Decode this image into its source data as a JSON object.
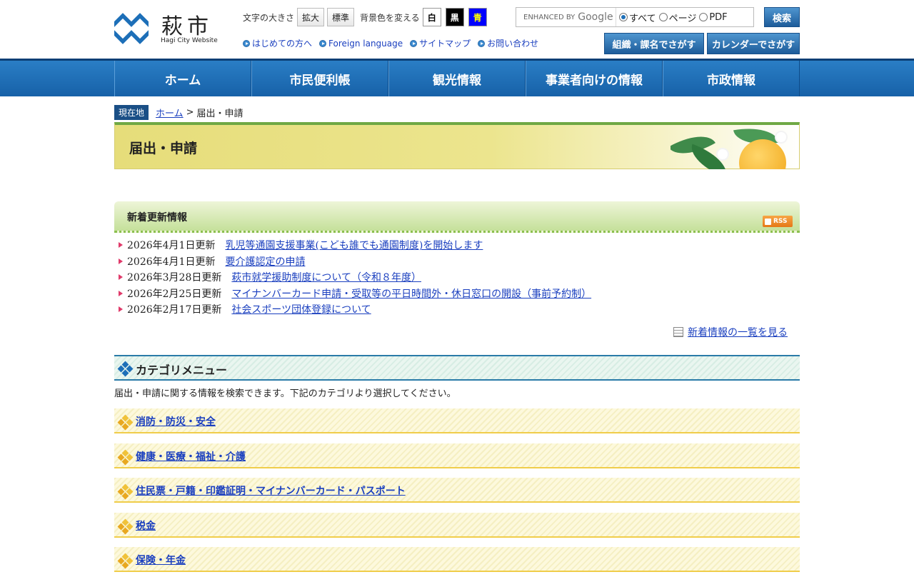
{
  "header": {
    "logo_kanji": "萩市",
    "logo_en": "Hagi City Website",
    "font_size_label": "文字の大きさ",
    "font_enlarge": "拡大",
    "font_standard": "標準",
    "bg_color_label": "背景色を変える",
    "bg_white": "白",
    "bg_black": "黒",
    "bg_blue": "青",
    "links": [
      {
        "label": "はじめての方へ"
      },
      {
        "label": "Foreign language"
      },
      {
        "label": "サイトマップ"
      },
      {
        "label": "お問い合わせ"
      }
    ],
    "search": {
      "enhanced_by": "ENHANCED BY",
      "google": "Google",
      "options": [
        "すべて",
        "ページ",
        "PDF"
      ],
      "selected": "すべて",
      "button": "検索"
    },
    "org_search_button": "組織・課名でさがす",
    "calendar_search_button": "カレンダーでさがす"
  },
  "nav": [
    "ホーム",
    "市民便利帳",
    "観光情報",
    "事業者向けの情報",
    "市政情報"
  ],
  "breadcrumb": {
    "here_label": "現在地",
    "home": "ホーム",
    "separator": ">",
    "current": "届出・申請"
  },
  "page_title": "届出・申請",
  "news": {
    "heading": "新着更新情報",
    "rss_label": "RSS",
    "items": [
      {
        "date": "2026年4月1日更新",
        "title": "乳児等通園支援事業(こども誰でも通園制度)を開始します"
      },
      {
        "date": "2026年4月1日更新",
        "title": "要介護認定の申請"
      },
      {
        "date": "2026年3月28日更新",
        "title": "萩市就学援助制度について（令和８年度）"
      },
      {
        "date": "2026年2月25日更新",
        "title": "マイナンバーカード申請・受取等の平日時間外・休日窓口の開設（事前予約制）"
      },
      {
        "date": "2026年2月17日更新",
        "title": "社会スポーツ団体登録について"
      }
    ],
    "more_link": "新着情報の一覧を見る"
  },
  "category": {
    "heading": "カテゴリメニュー",
    "description": "届出・申請に関する情報を検索できます。下記のカテゴリより選択してください。",
    "items": [
      {
        "label": "消防・防災・安全"
      },
      {
        "label": "健康・医療・福祉・介護"
      },
      {
        "label": "住民票・戸籍・印鑑証明・マイナンバーカード・パスポート"
      },
      {
        "label": "税金"
      },
      {
        "label": "保険・年金"
      }
    ]
  },
  "colors": {
    "brand_blue": "#1d6fb8",
    "nav_blue": "#1761a8",
    "link": "#1a3fbf",
    "news_green": "#8cc04f",
    "category_yellow": "#f0cd4a"
  }
}
